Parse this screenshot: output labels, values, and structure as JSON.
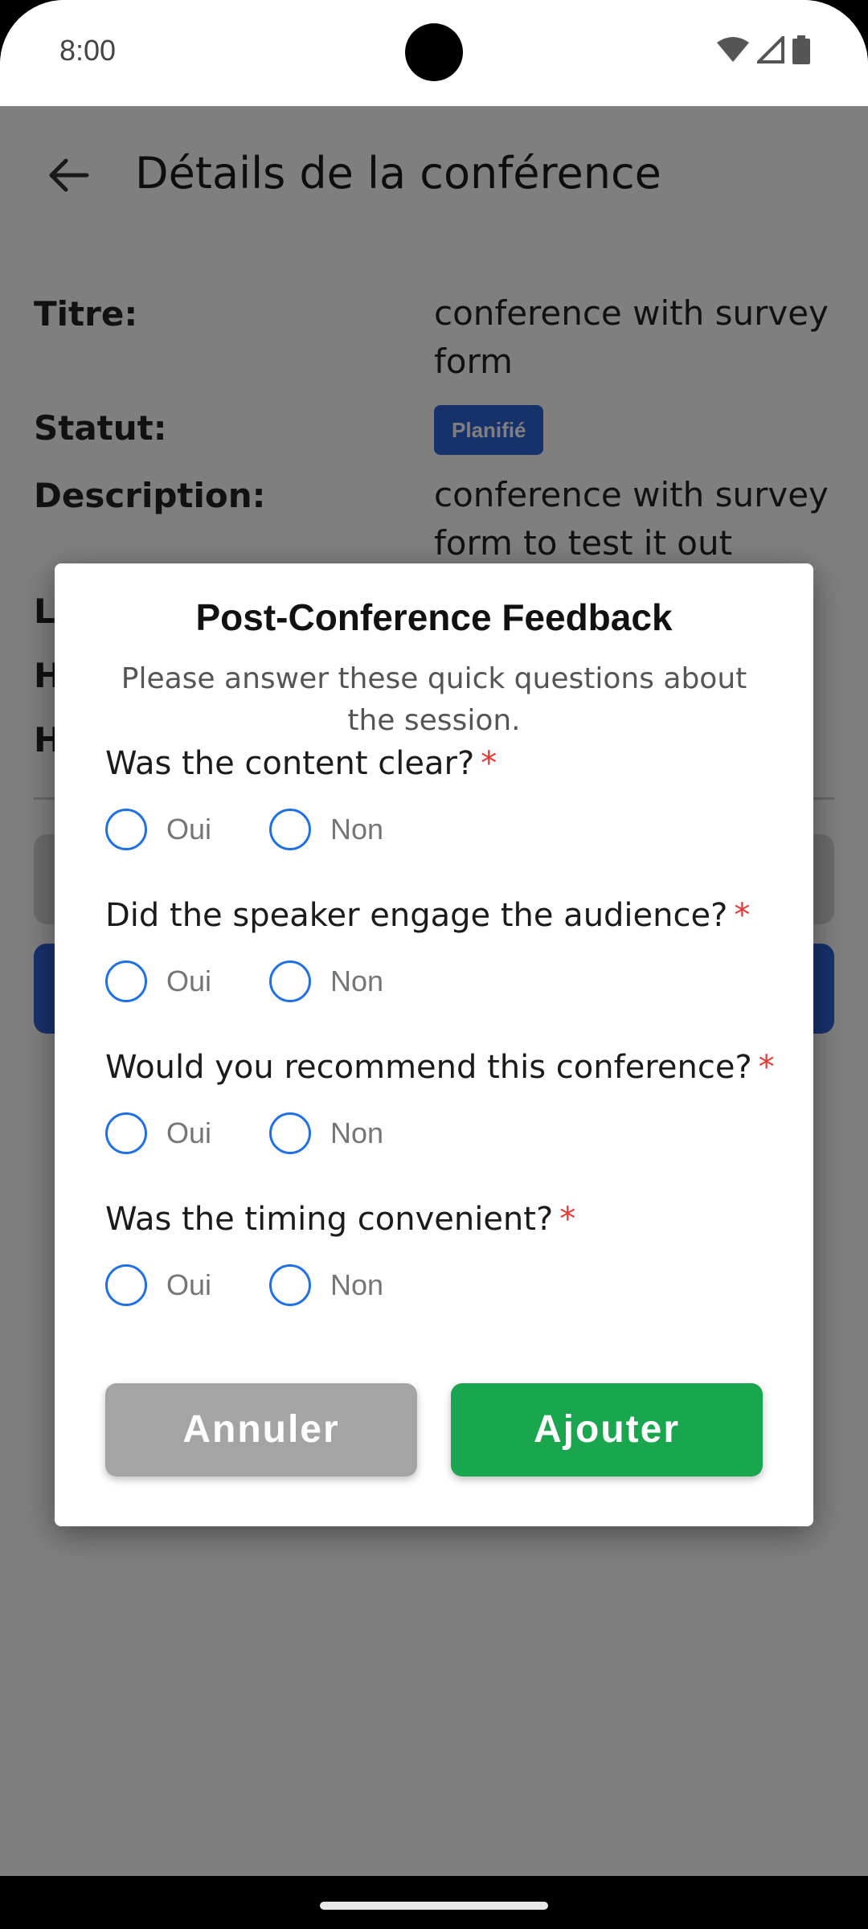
{
  "status_bar": {
    "time": "8:00",
    "icons": [
      "wifi-icon",
      "signal-icon",
      "battery-icon"
    ]
  },
  "page": {
    "title": "Détails de la conférence",
    "details": [
      {
        "label": "Titre:",
        "value": "conference with survey form"
      },
      {
        "label": "Statut:",
        "status_chip": "Planifié"
      },
      {
        "label": "Description:",
        "value": "conference with survey form to test it out"
      }
    ],
    "partial_labels": [
      "L",
      "H",
      "H"
    ]
  },
  "dialog": {
    "title": "Post-Conference Feedback",
    "subtitle": "Please answer these quick questions about the session.",
    "required_mark": "*",
    "questions": [
      {
        "text": "Was the content clear?",
        "options": [
          "Oui",
          "Non"
        ]
      },
      {
        "text": "Did the speaker engage the audience?",
        "options": [
          "Oui",
          "Non"
        ]
      },
      {
        "text": "Would you recommend this conference?",
        "options": [
          "Oui",
          "Non"
        ]
      },
      {
        "text": "Was the timing convenient?",
        "options": [
          "Oui",
          "Non"
        ]
      }
    ],
    "cancel_label": "Annuler",
    "add_label": "Ajouter"
  },
  "colors": {
    "accent_blue": "#2f63d6",
    "radio_blue": "#1f6fe5",
    "add_green": "#1aa54f",
    "cancel_grey": "#a4a4a4",
    "required_red": "#e53935"
  }
}
